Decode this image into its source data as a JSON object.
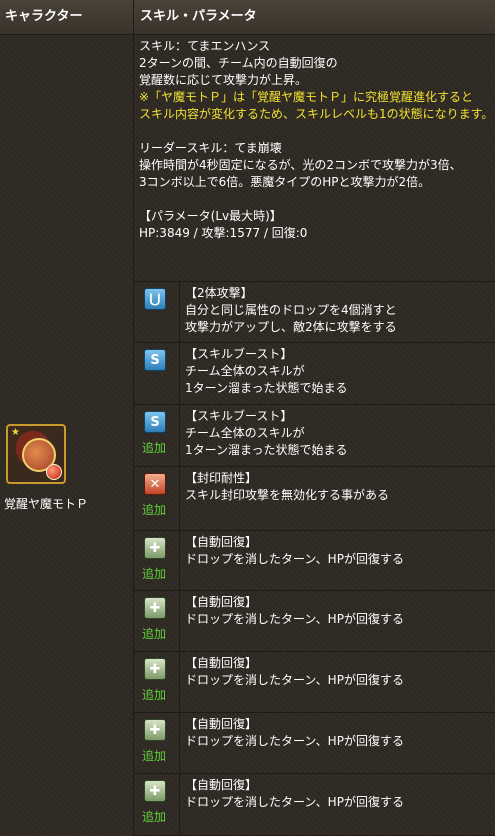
{
  "header": {
    "col_character": "キャラクター",
    "col_skill": "スキル・パラメータ"
  },
  "character": {
    "name": "覚醒ヤ魔モトＰ",
    "icon": "devil-character-portrait"
  },
  "skill": {
    "title": "スキル：てまエンハンス",
    "lines": [
      "2ターンの間、チーム内の自動回復の",
      "覚醒数に応じて攻撃力が上昇。"
    ],
    "note_lines": [
      "※「ヤ魔モトＰ」は「覚醒ヤ魔モトＰ」に究極覚醒進化すると",
      "スキル内容が変化するため、スキルレベルも1の状態になります。"
    ],
    "note_color": "#f2e232"
  },
  "leader": {
    "title": "リーダースキル：てま崩壊",
    "lines": [
      "操作時間が4秒固定になるが、光の2コンボで攻撃力が3倍、",
      "3コンボ以上で6倍。悪魔タイプのHPと攻撃力が2倍。"
    ]
  },
  "params": {
    "title": "【パラメータ(Lv最大時)】",
    "values": "HP:3849 / 攻撃:1577 / 回復:0"
  },
  "awakenings": [
    {
      "icon": "two-way-attack-icon",
      "added": "",
      "title": "【2体攻撃】",
      "lines": [
        "自分と同じ属性のドロップを4個消すと",
        "攻撃力がアップし、敵2体に攻撃をする"
      ]
    },
    {
      "icon": "skill-boost-icon",
      "added": "",
      "title": "【スキルブースト】",
      "lines": [
        "チーム全体のスキルが",
        "1ターン溜まった状態で始まる"
      ]
    },
    {
      "icon": "skill-boost-icon",
      "added": "追加",
      "title": "【スキルブースト】",
      "lines": [
        "チーム全体のスキルが",
        "1ターン溜まった状態で始まる"
      ]
    },
    {
      "icon": "seal-resist-icon",
      "added": "追加",
      "title": "【封印耐性】",
      "lines": [
        "スキル封印攻撃を無効化する事がある"
      ]
    },
    {
      "icon": "auto-recover-icon",
      "added": "追加",
      "title": "【自動回復】",
      "lines": [
        "ドロップを消したターン、HPが回復する"
      ]
    },
    {
      "icon": "auto-recover-icon",
      "added": "追加",
      "title": "【自動回復】",
      "lines": [
        "ドロップを消したターン、HPが回復する"
      ]
    },
    {
      "icon": "auto-recover-icon",
      "added": "追加",
      "title": "【自動回復】",
      "lines": [
        "ドロップを消したターン、HPが回復する"
      ]
    },
    {
      "icon": "auto-recover-icon",
      "added": "追加",
      "title": "【自動回復】",
      "lines": [
        "ドロップを消したターン、HPが回復する"
      ]
    },
    {
      "icon": "auto-recover-icon",
      "added": "追加",
      "title": "【自動回復】",
      "lines": [
        "ドロップを消したターン、HPが回復する"
      ]
    }
  ],
  "colors": {
    "added_text": "#5fd23b",
    "background": "#2e2923"
  }
}
